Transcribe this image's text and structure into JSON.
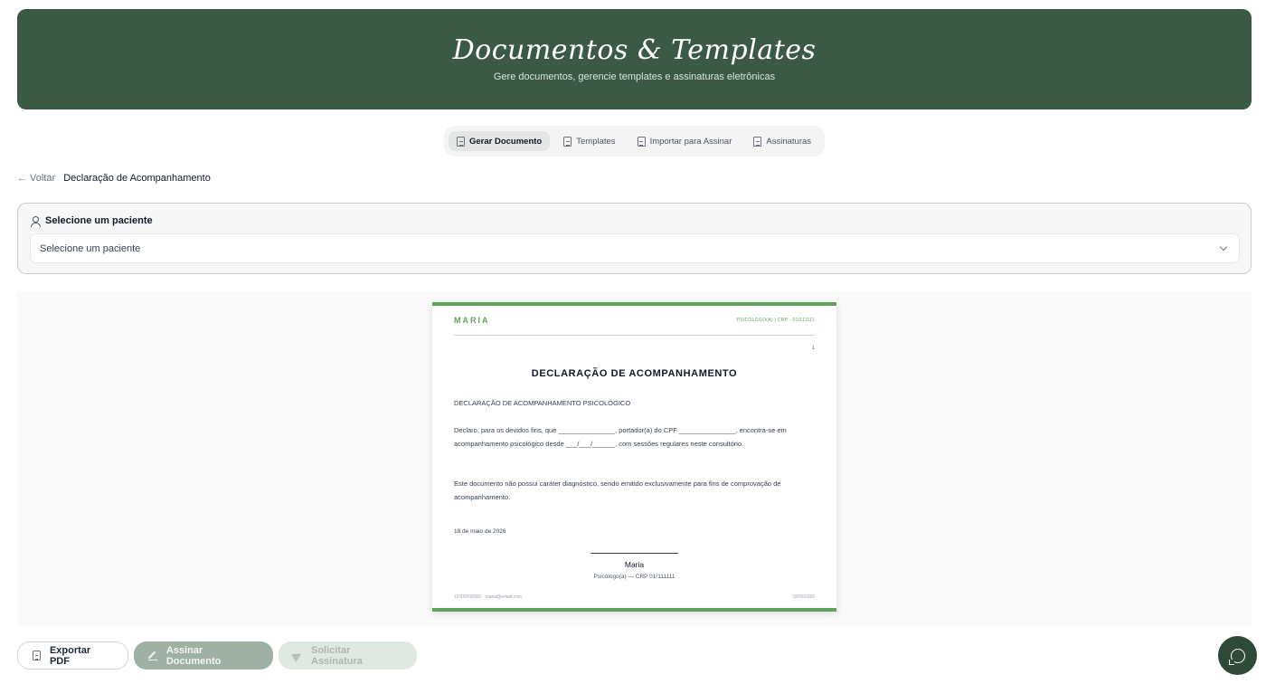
{
  "header": {
    "title": "Documentos & Templates",
    "subtitle": "Gere documentos, gerencie templates e assinaturas eletrônicas"
  },
  "tabs": [
    {
      "label": "Gerar Documento",
      "active": true,
      "icon": "file-icon"
    },
    {
      "label": "Templates",
      "active": false,
      "icon": "file-text-icon"
    },
    {
      "label": "Importar para Assinar",
      "active": false,
      "icon": "file-import-icon"
    },
    {
      "label": "Assinaturas",
      "active": false,
      "icon": "file-signature-icon"
    }
  ],
  "breadcrumb": {
    "back_label": "← Voltar",
    "title": "Declaração de Acompanhamento"
  },
  "patient": {
    "label": "Selecione um paciente",
    "selected_value": "Selecione um paciente"
  },
  "document": {
    "brand": "MARIA",
    "header_right": "PSICÓLOGO(A) | CRP - 01/111111",
    "page_number": "1",
    "title": "DECLARAÇÃO DE ACOMPANHAMENTO",
    "subheading": "DECLARAÇÃO DE ACOMPANHAMENTO PSICOLÓGICO",
    "paragraph1": "Declaro, para os devidos fins, que _______________, portador(a) do CPF _______________, encontra-se em acompanhamento psicológico desde ___/___/______, com sessões regulares neste consultório.",
    "paragraph2": "Este documento não possui caráter diagnóstico, sendo emitido exclusivamente para fins de comprovação de acompanhamento.",
    "date": "18 de maio de 2026",
    "signer_name": "Maria",
    "signer_role": "Psicólogo(a) — CRP 01/111111",
    "footer_contact": "11000000000 · maria@email.com",
    "footer_date": "18/05/2026"
  },
  "actions": {
    "export_pdf": "Exportar PDF",
    "sign_document": "Assinar Documento",
    "request_signature": "Solicitar Assinatura"
  },
  "colors": {
    "header_bg": "#3b5a45",
    "accent": "#5fa35a"
  }
}
